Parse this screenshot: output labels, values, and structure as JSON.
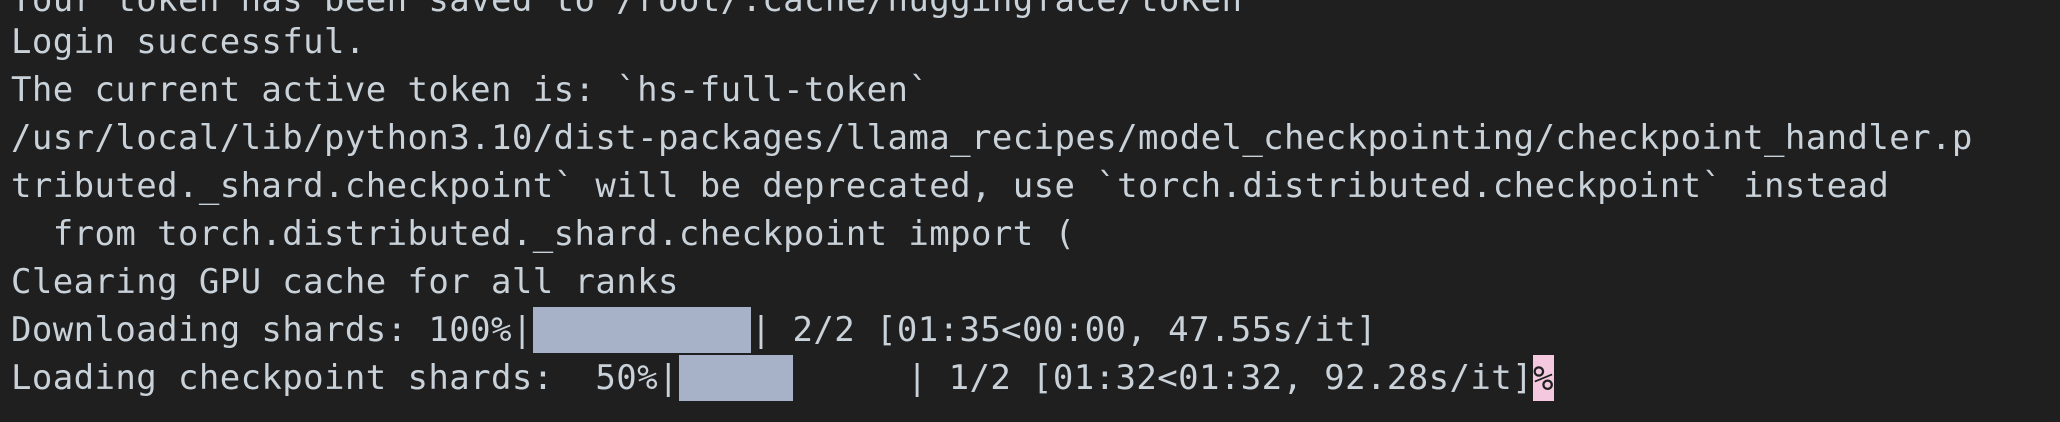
{
  "terminal": {
    "lines": {
      "l0": "Your token has been saved to /root/.cache/huggingface/token",
      "l1": "Login successful.",
      "l2": "The current active token is: `hs-full-token`",
      "l3": "/usr/local/lib/python3.10/dist-packages/llama_recipes/model_checkpointing/checkpoint_handler.p",
      "l4": "tributed._shard.checkpoint` will be deprecated, use `torch.distributed.checkpoint` instead",
      "l5": "  from torch.distributed._shard.checkpoint import (",
      "l6": "Clearing GPU cache for all ranks"
    },
    "download": {
      "prefix": "Downloading shards: 100%|",
      "progress": 1.0,
      "suffix": "| 2/2 [01:35<00:00, 47.55s/it]"
    },
    "loading": {
      "prefix": "Loading checkpoint shards:  50%|",
      "progress": 0.5,
      "suffix": "| 1/2 [01:32<01:32, 92.28s/it]"
    },
    "cursor_char": "%"
  },
  "colors": {
    "background": "#1f1f1f",
    "text": "#c9d1d9",
    "progress_fill": "#a7b2c8",
    "cursor": "#f4c9df"
  }
}
